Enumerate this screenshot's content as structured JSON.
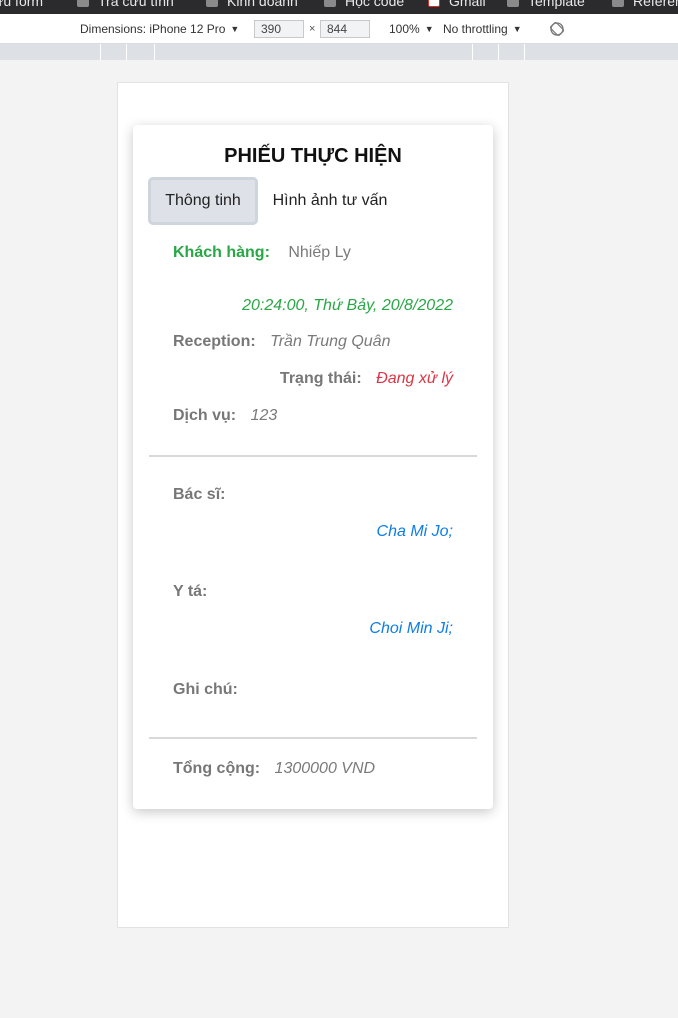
{
  "browser": {
    "bookmarks": [
      "ưu form",
      "Tra cứu tính",
      "Kinh doanh",
      "Học code",
      "Gmail",
      "Template",
      "Referen"
    ]
  },
  "devtools": {
    "dimensions_label": "Dimensions: iPhone 12 Pro",
    "width_value": "390",
    "times_sign": "×",
    "height_value": "844",
    "zoom": "100%",
    "throttling": "No throttling"
  },
  "page": {
    "title": "PHIẾU THỰC HIỆN",
    "tabs": [
      {
        "label": "Thông tinh",
        "active": true
      },
      {
        "label": "Hình ảnh tư vấn",
        "active": false
      }
    ],
    "customer": {
      "label": "Khách hàng:",
      "value": "Nhiếp Ly"
    },
    "datetime": "20:24:00, Thứ Bảy, 20/8/2022",
    "reception": {
      "label": "Reception:",
      "value": "Trần Trung Quân"
    },
    "status": {
      "label": "Trạng thái:",
      "value": "Đang xử lý"
    },
    "service": {
      "label": "Dịch vụ:",
      "value": "123"
    },
    "doctor": {
      "label": "Bác sĩ:",
      "value": "Cha Mi Jo;"
    },
    "nurse": {
      "label": "Y tá:",
      "value": "Choi Min Ji;"
    },
    "note": {
      "label": "Ghi chú:",
      "value": ""
    },
    "total": {
      "label": "Tổng cộng:",
      "value": "1300000 VND"
    }
  },
  "colors": {
    "customer_label": "#28a745",
    "datetime": "#28a745",
    "status_value": "#dc3545",
    "staff_names": "#0d7ee6",
    "active_tab_bg": "#dee2e8"
  }
}
